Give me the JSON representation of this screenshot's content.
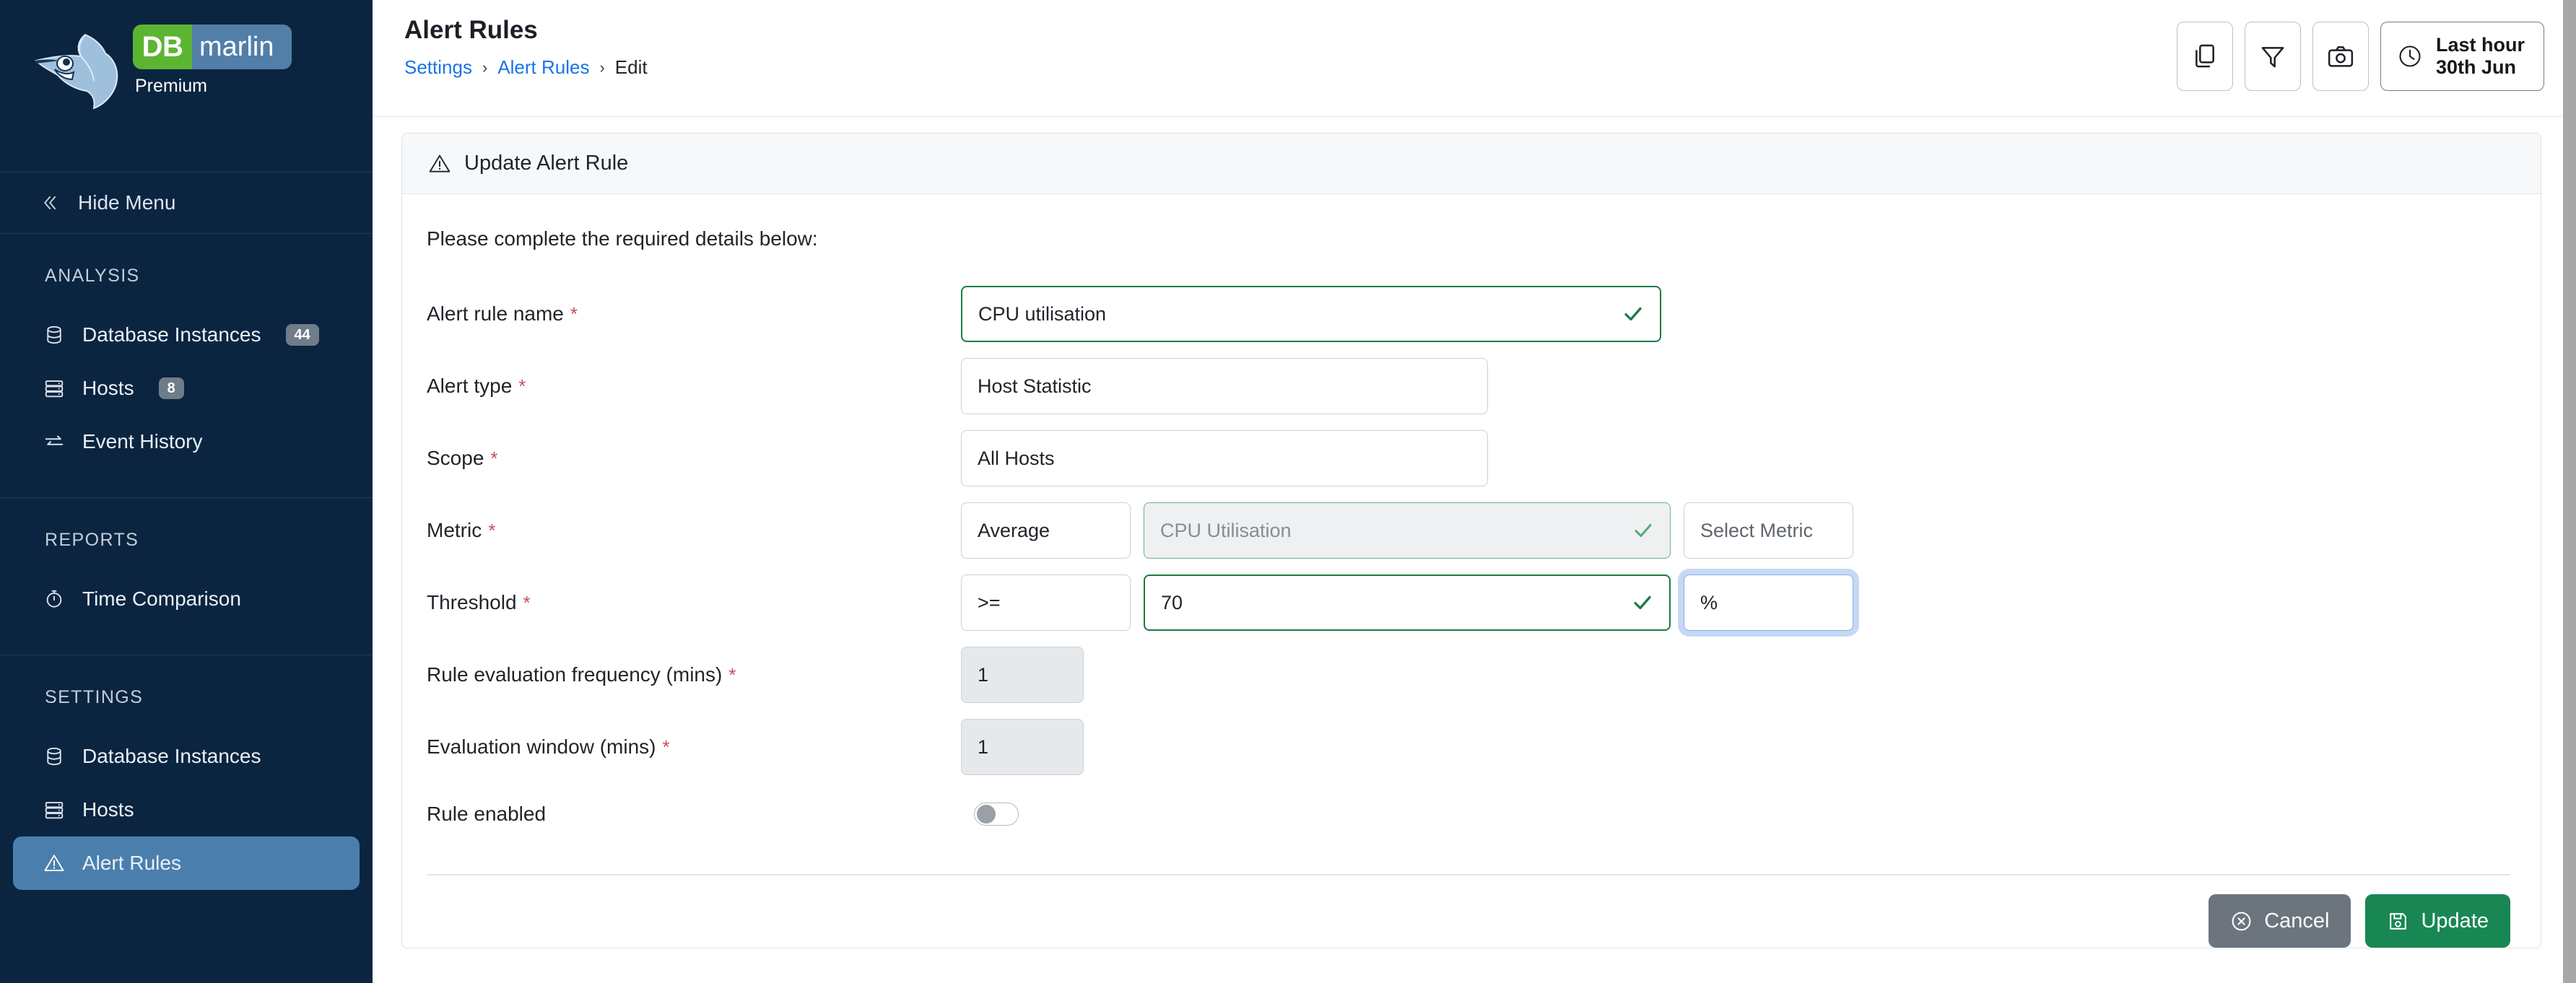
{
  "sidebar": {
    "logo": {
      "db": "DB",
      "marlin": "marlin",
      "edition": "Premium"
    },
    "hide_menu": {
      "label": "Hide Menu",
      "icon": "double-chevron-left-icon"
    },
    "sections": [
      {
        "heading": "ANALYSIS",
        "items": [
          {
            "label": "Database Instances",
            "icon": "database-icon",
            "badge": "44",
            "active": false
          },
          {
            "label": "Hosts",
            "icon": "server-rack-icon",
            "badge": "8",
            "active": false
          },
          {
            "label": "Event History",
            "icon": "exchange-arrows-icon",
            "badge": "",
            "active": false
          }
        ]
      },
      {
        "heading": "REPORTS",
        "items": [
          {
            "label": "Time Comparison",
            "icon": "stopwatch-icon",
            "badge": "",
            "active": false
          }
        ]
      },
      {
        "heading": "SETTINGS",
        "items": [
          {
            "label": "Database Instances",
            "icon": "database-icon",
            "badge": "",
            "active": false
          },
          {
            "label": "Hosts",
            "icon": "server-rack-icon",
            "badge": "",
            "active": false
          },
          {
            "label": "Alert Rules",
            "icon": "warning-triangle-icon",
            "badge": "",
            "active": true
          }
        ]
      }
    ],
    "active_bg": "#4a7fad",
    "bg": "#0b2541"
  },
  "header": {
    "title": "Alert Rules",
    "breadcrumb": {
      "settings": "Settings",
      "alert_rules": "Alert Rules",
      "current": "Edit",
      "separator": "›"
    },
    "toolbar": {
      "copy_icon": "copy-pages-icon",
      "filter_icon": "funnel-filter-icon",
      "snapshot_icon": "camera-icon",
      "time_range": {
        "icon": "clock-icon",
        "line1": "Last hour",
        "line2": "30th Jun"
      }
    },
    "link_color": "#1a73e8"
  },
  "panel": {
    "icon": "warning-triangle-icon",
    "title": "Update Alert Rule",
    "intro": "Please complete the required details below:",
    "required_marker": "*",
    "valid_icon": "green-check-icon"
  },
  "form": {
    "rows": [
      {
        "label": "Alert rule name",
        "required": true,
        "value": "CPU utilisation"
      },
      {
        "label": "Alert type",
        "required": true,
        "value": "Host Statistic"
      },
      {
        "label": "Scope",
        "required": true,
        "value": "All Hosts"
      },
      {
        "label": "Metric",
        "required": true,
        "aggregate": "Average",
        "metric_value": "CPU Utilisation",
        "select_placeholder": "Select Metric"
      },
      {
        "label": "Threshold",
        "required": true,
        "operator": ">=",
        "number": "70",
        "unit": "%"
      },
      {
        "label": "Rule evaluation frequency (mins)",
        "required": true,
        "value": "1"
      },
      {
        "label": "Evaluation window (mins)",
        "required": true,
        "value": "1"
      },
      {
        "label": "Rule enabled",
        "required": false,
        "toggle_on": false
      }
    ]
  },
  "actions": {
    "cancel": {
      "label": "Cancel",
      "icon": "circle-x-icon",
      "color": "#6c757d"
    },
    "update": {
      "label": "Update",
      "icon": "floppy-save-icon",
      "color": "#198754"
    }
  },
  "colors": {
    "valid_green": "#1b7a45",
    "required_red": "#c9505a",
    "focus_blue": "#c5d9f5"
  }
}
